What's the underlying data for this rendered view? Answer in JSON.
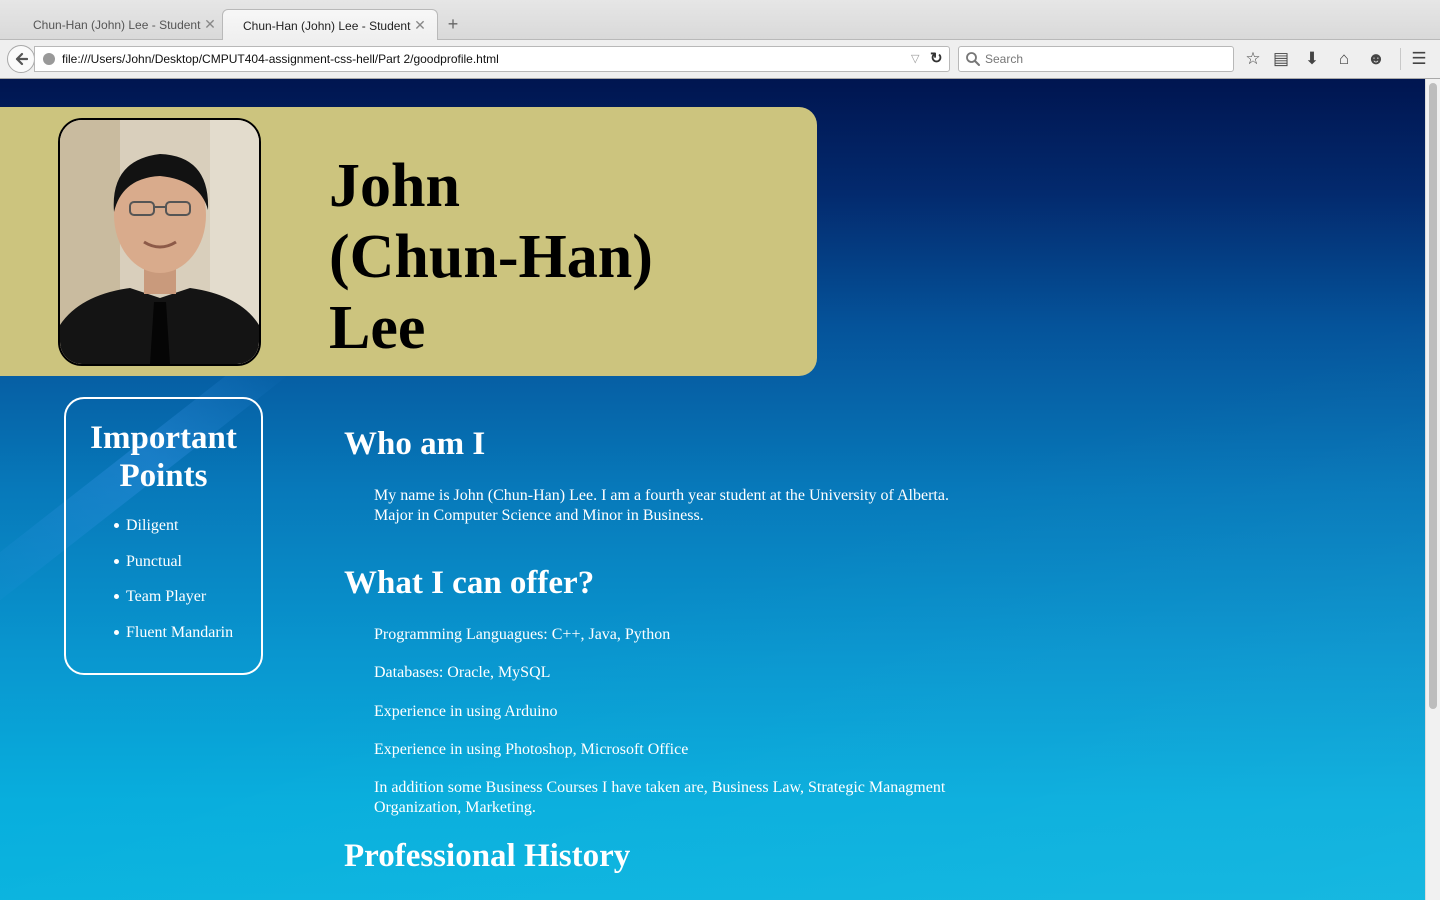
{
  "browser": {
    "tabs": [
      {
        "title": "Chun-Han (John) Lee - Student",
        "active": false
      },
      {
        "title": "Chun-Han (John) Lee - Student",
        "active": true
      }
    ],
    "url": "file:///Users/John/Desktop/CMPUT404-assignment-css-hell/Part 2/goodprofile.html",
    "search_placeholder": "Search",
    "toolbar_icons": [
      "star-icon",
      "reading-list-icon",
      "download-icon",
      "home-icon",
      "chat-icon",
      "menu-icon"
    ]
  },
  "page": {
    "name": "John (Chun-Han) Lee",
    "name_lines": [
      "John",
      "(Chun-Han)",
      "Lee"
    ],
    "colors": {
      "header_bg": "#ccc47e",
      "text": "#ffffff"
    },
    "important_points": {
      "title": "Important Points",
      "items": [
        "Diligent",
        "Punctual",
        "Team Player",
        "Fluent Mandarin"
      ]
    },
    "sections": {
      "who": {
        "heading": "Who am I",
        "text": "My name is John (Chun-Han) Lee. I am a fourth year student at the University of Alberta. Major in Computer Science and Minor in Business."
      },
      "offer": {
        "heading": "What I can offer?",
        "items": [
          "Programming Languagues: C++, Java, Python",
          "Databases: Oracle, MySQL",
          "Experience in using Arduino",
          "Experience in using Photoshop, Microsoft Office",
          "In addition some Business Courses I have taken are, Business Law, Strategic Managment Organization, Marketing."
        ]
      },
      "history": {
        "heading": "Professional History"
      }
    }
  }
}
